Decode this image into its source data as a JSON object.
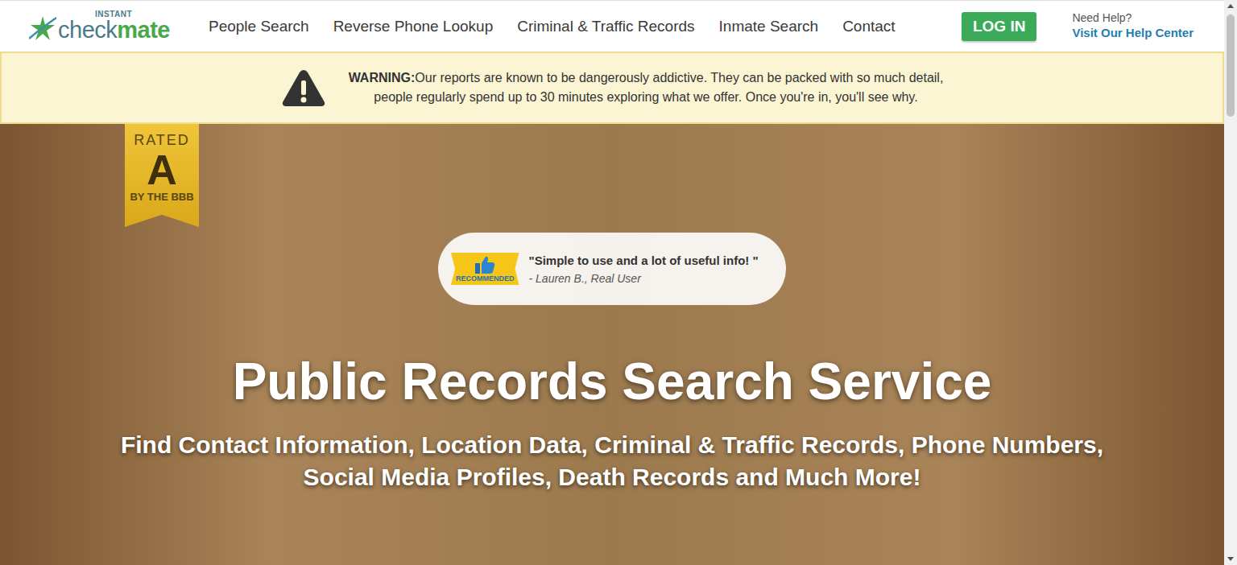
{
  "logo": {
    "prefix": "INSTANT",
    "name_a": "check",
    "name_b": "mate"
  },
  "nav": {
    "items": [
      {
        "label": "People Search"
      },
      {
        "label": "Reverse Phone Lookup"
      },
      {
        "label": "Criminal & Traffic Records"
      },
      {
        "label": "Inmate Search"
      },
      {
        "label": "Contact"
      }
    ],
    "login": "LOG IN",
    "help_label": "Need Help?",
    "help_link": "Visit Our Help Center"
  },
  "warning": {
    "label": "WARNING:",
    "lines": [
      "Our reports are known to be dangerously addictive. They can be packed with so much detail,",
      "people regularly spend up to 30 minutes exploring what we offer. Once you're in, you'll see why."
    ]
  },
  "badge": {
    "top": "RATED",
    "grade": "A",
    "bottom": "BY THE BBB"
  },
  "testimonial": {
    "ribbon": "RECOMMENDED",
    "quote": "\"Simple to use and a lot of useful info! \"",
    "author": "- Lauren B., Real User"
  },
  "hero": {
    "title": "Public Records Search Service",
    "subtitle_lines": [
      "Find Contact Information, Location Data, Criminal & Traffic Records, Phone Numbers,",
      "Social Media Profiles, Death Records and Much More!"
    ]
  },
  "scrollbar": {
    "level": 0.19
  }
}
